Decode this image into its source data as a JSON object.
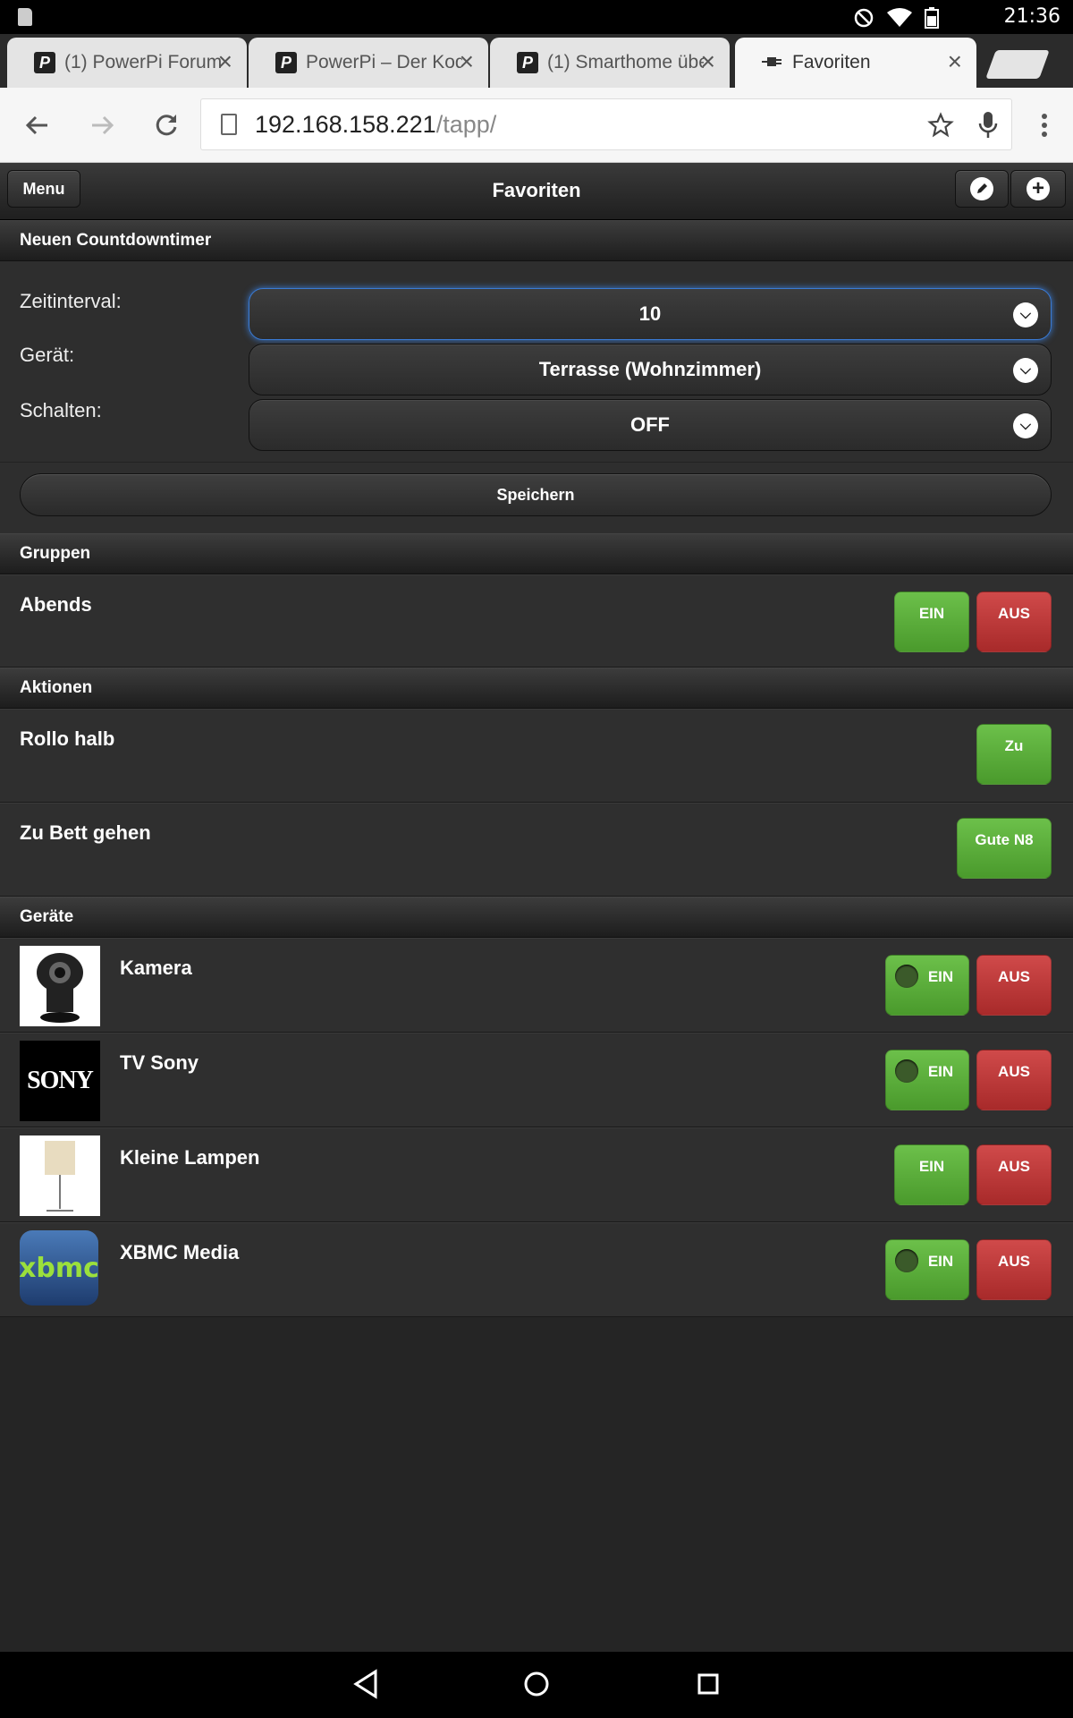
{
  "status": {
    "time": "21:36"
  },
  "tabs": [
    {
      "title": "(1) PowerPi Forum"
    },
    {
      "title": "PowerPi – Der Kod"
    },
    {
      "title": "(1) Smarthome übe"
    },
    {
      "title": "Favoriten"
    }
  ],
  "omnibox": {
    "host": "192.168.158.221",
    "path": "/tapp/"
  },
  "header": {
    "menu": "Menu",
    "title": "Favoriten"
  },
  "countdown": {
    "heading": "Neuen Countdowntimer",
    "interval_label": "Zeitinterval:",
    "interval_value": "10",
    "device_label": "Gerät:",
    "device_value": "Terrasse (Wohnzimmer)",
    "switch_label": "Schalten:",
    "switch_value": "OFF",
    "save": "Speichern"
  },
  "groups": {
    "heading": "Gruppen",
    "items": [
      {
        "name": "Abends",
        "on": "EIN",
        "off": "AUS"
      }
    ]
  },
  "actions": {
    "heading": "Aktionen",
    "items": [
      {
        "name": "Rollo halb",
        "button": "Zu"
      },
      {
        "name": "Zu Bett gehen",
        "button": "Gute N8"
      }
    ]
  },
  "devices": {
    "heading": "Geräte",
    "items": [
      {
        "name": "Kamera",
        "on": "EIN",
        "off": "AUS"
      },
      {
        "name": "TV Sony",
        "on": "EIN",
        "off": "AUS",
        "logo": "SONY"
      },
      {
        "name": "Kleine Lampen",
        "on": "EIN",
        "off": "AUS"
      },
      {
        "name": "XBMC Media",
        "on": "EIN",
        "off": "AUS",
        "logo": "xbmc"
      }
    ]
  },
  "colors": {
    "green": "#5aae3a",
    "red": "#bc3a3a",
    "focus": "#3a7bd5"
  }
}
